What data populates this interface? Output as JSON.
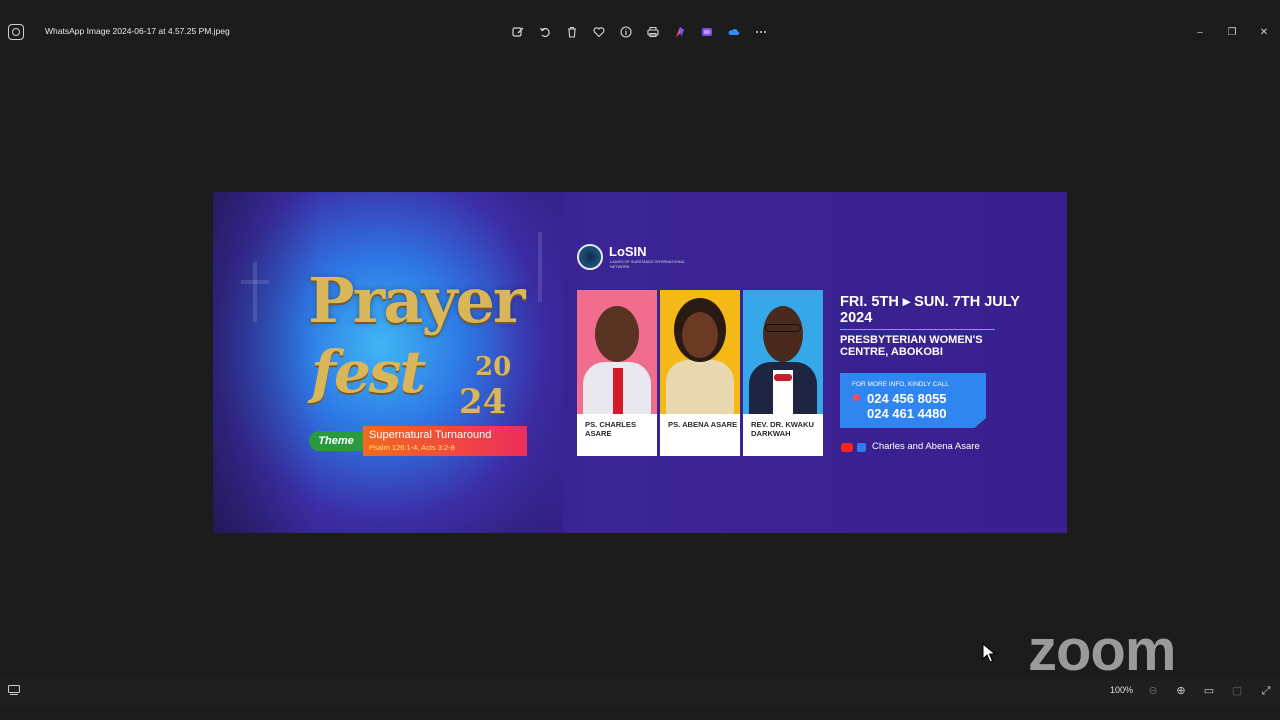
{
  "window": {
    "file_name": "WhatsApp Image 2024-06-17 at 4.57.25 PM.jpeg",
    "toolbar_icons": [
      "edit-image-icon",
      "rotate-icon",
      "delete-icon",
      "favorite-icon",
      "info-icon",
      "print-icon",
      "designer-icon",
      "clipchamp-icon",
      "onedrive-icon",
      "more-icon"
    ],
    "controls": {
      "minimize": "–",
      "restore": "❐",
      "close": "✕"
    }
  },
  "poster": {
    "title_word1": "Prayer",
    "title_word2": "fest",
    "year_top": "20",
    "year_bottom": "24",
    "theme_label": "Theme",
    "theme_title": "Supernatural Turnaround",
    "theme_verse": "Psalm 126:1-4,  Acts 3:2-8",
    "org_name": "LoSIN",
    "org_subtitle": "LADIES OF SUBSTANCE INTERNATIONAL NETWORK",
    "speakers": [
      {
        "name": "PS. CHARLES ASARE",
        "bg": "#f06d8e"
      },
      {
        "name": "PS. ABENA ASARE",
        "bg": "#f4b916"
      },
      {
        "name": "REV. DR. KWAKU DARKWAH",
        "bg": "#36a8ea"
      }
    ],
    "dates": "FRI. 5TH ▸ SUN. 7TH JULY 2024",
    "venue": "PRESBYTERIAN WOMEN'S CENTRE, ABOKOBI",
    "info_label": "FOR MORE INFO, KINDLY CALL",
    "phone1": "024 456 8055",
    "phone2": "024 461 4480",
    "social_name": "Charles and Abena Asare"
  },
  "overlay": {
    "watermark": "zoom"
  },
  "statusbar": {
    "zoom_level": "100%",
    "zoom_out": "⊖",
    "zoom_in": "⊕",
    "fit": "▭",
    "actual": "▢",
    "fullscreen": "⤢"
  }
}
